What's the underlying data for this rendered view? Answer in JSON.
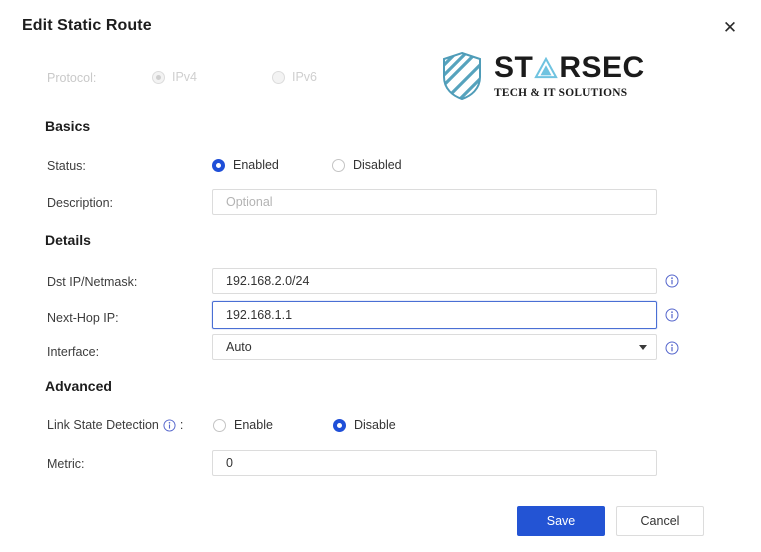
{
  "dialog": {
    "title": "Edit Static Route",
    "close_label": "✕"
  },
  "protocol": {
    "label": "Protocol:",
    "options": [
      {
        "label": "IPv4",
        "selected": true
      },
      {
        "label": "IPv6",
        "selected": false
      }
    ]
  },
  "logo": {
    "word_part1": "ST",
    "word_part2": "RSEC",
    "tagline": "TECH & IT SOLUTIONS",
    "shield_color": "#4f9cb8",
    "triangle_color": "#6fc3e0"
  },
  "sections": {
    "basics": "Basics",
    "details": "Details",
    "advanced": "Advanced"
  },
  "basics": {
    "status_label": "Status:",
    "status_options": [
      {
        "label": "Enabled",
        "selected": true
      },
      {
        "label": "Disabled",
        "selected": false
      }
    ],
    "description_label": "Description:",
    "description_value": "",
    "description_placeholder": "Optional"
  },
  "details": {
    "dst_label": "Dst IP/Netmask:",
    "dst_value": "192.168.2.0/24",
    "nexthop_label": "Next-Hop IP:",
    "nexthop_value": "192.168.1.1",
    "interface_label": "Interface:",
    "interface_value": "Auto"
  },
  "advanced": {
    "link_state_label": "Link State Detection",
    "link_state_colon": ":",
    "link_state_options": [
      {
        "label": "Enable",
        "selected": false
      },
      {
        "label": "Disable",
        "selected": true
      }
    ],
    "metric_label": "Metric:",
    "metric_value": "0"
  },
  "footer": {
    "save_label": "Save",
    "cancel_label": "Cancel"
  },
  "colors": {
    "accent_blue": "#2354d4",
    "radio_blue": "#1f4fd8",
    "focus_border": "#4a6fd4",
    "info_icon": "#5566cc"
  }
}
